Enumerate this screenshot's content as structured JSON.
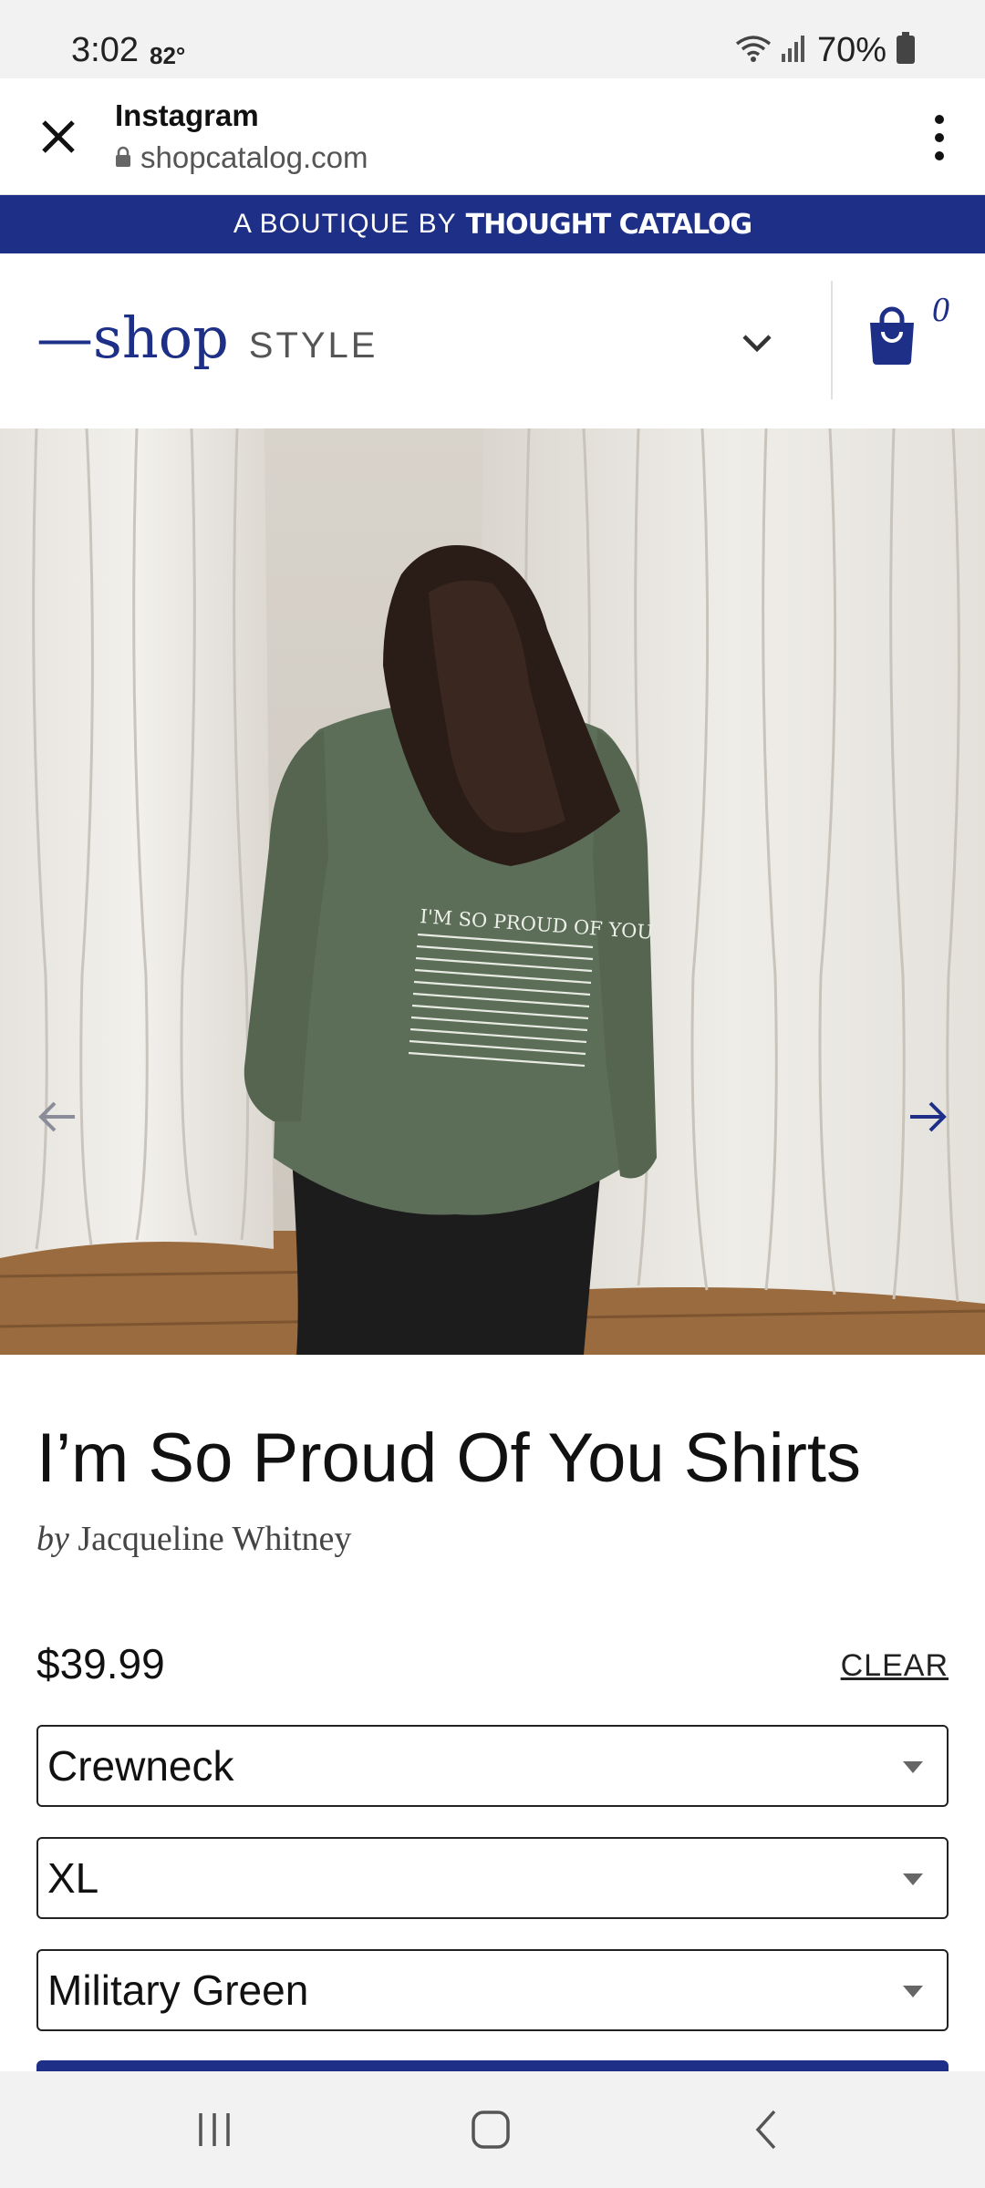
{
  "status_bar": {
    "time": "3:02",
    "temperature": "82°",
    "battery": "70%"
  },
  "browser": {
    "title": "Instagram",
    "url": "shopcatalog.com"
  },
  "promo_banner": {
    "prefix": "A BOUTIQUE BY",
    "brand": "THOUGHT CATALOG"
  },
  "header": {
    "logo_text": "—shop",
    "section": "STYLE",
    "cart_count": "0"
  },
  "product": {
    "title": "I’m So Proud Of You Shirts",
    "by_prefix": "by",
    "author": "Jacqueline Whitney",
    "price": "$39.99",
    "clear_label": "CLEAR",
    "options": {
      "style": "Crewneck",
      "size": "XL",
      "color": "Military Green"
    },
    "image": {
      "print_heading": "I'M SO PROUD OF YOU",
      "print_body": [
        "I'm so proud of you for doing your best to be",
        "okay. I'm so proud of you for waking up every",
        "day and trying. I'm so proud of you for being",
        "here today because I know some of your yester-",
        "days were really hard. I don't know what you're",
        "going through, but you are going to get through",
        "it. You are going to get through whatever you're",
        "going through. I hope you fight for yourself",
        "when no one else does and I hope you know",
        "you are worthy of your wildest dreams. You",
        "are someone worth fighting for. Keep going."
      ]
    }
  },
  "colors": {
    "brand_navy": "#1d2f86",
    "sweatshirt": "#5d6e58"
  }
}
